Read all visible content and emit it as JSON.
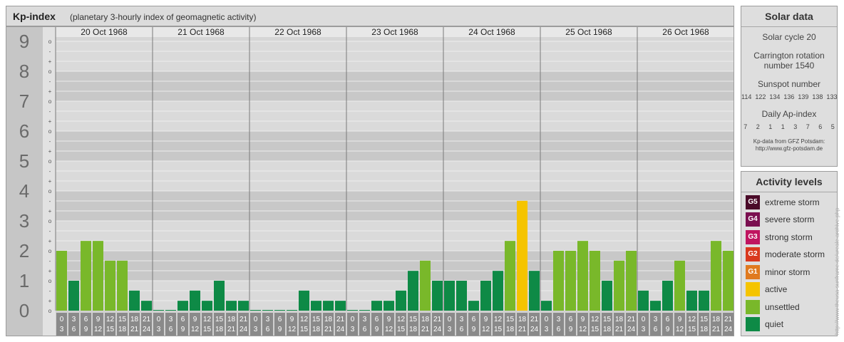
{
  "header": {
    "title": "Kp-index",
    "subtitle": "(planetary 3-hourly index of geomagnetic activity)"
  },
  "chart_data": {
    "type": "bar",
    "ylim": [
      0,
      9
    ],
    "y_ticks": [
      "0",
      "1",
      "2",
      "3",
      "4",
      "5",
      "6",
      "7",
      "8",
      "9"
    ],
    "sub_ticks": [
      "+",
      "o",
      "-"
    ],
    "days": [
      "20 Oct 1968",
      "21 Oct 1968",
      "22 Oct 1968",
      "23 Oct 1968",
      "24 Oct 1968",
      "25 Oct 1968",
      "26 Oct 1968"
    ],
    "slot_top": [
      "0",
      "3",
      "6",
      "9",
      "12",
      "15",
      "18",
      "21"
    ],
    "slot_bottom": [
      "3",
      "6",
      "9",
      "12",
      "15",
      "18",
      "21",
      "24"
    ],
    "values": [
      [
        2.0,
        1.0,
        2.33,
        2.33,
        1.67,
        1.67,
        0.67,
        0.33
      ],
      [
        0.0,
        0.0,
        0.33,
        0.67,
        0.33,
        1.0,
        0.33,
        0.33
      ],
      [
        0.0,
        0.0,
        0.0,
        0.0,
        0.67,
        0.33,
        0.33,
        0.33
      ],
      [
        0.0,
        0.0,
        0.33,
        0.33,
        0.67,
        1.33,
        1.67,
        1.0
      ],
      [
        1.0,
        1.0,
        0.33,
        1.0,
        1.33,
        2.33,
        3.67,
        1.33
      ],
      [
        0.33,
        2.0,
        2.0,
        2.33,
        2.0,
        1.0,
        1.67,
        2.0
      ],
      [
        0.67,
        0.33,
        1.0,
        1.67,
        0.67,
        0.67,
        2.33,
        2.0
      ]
    ],
    "colors": {
      "quiet": "#0e8a46",
      "unsettled": "#79b82a",
      "active": "#f5c400",
      "g1": "#e07a1f",
      "g2": "#d9391e",
      "g3": "#c01560",
      "g4": "#7a1050",
      "g5": "#4a0a28"
    }
  },
  "solar": {
    "title": "Solar data",
    "cycle": "Solar cycle 20",
    "carrington_1": "Carrington rotation",
    "carrington_2": "number 1540",
    "sunspot_title": "Sunspot number",
    "sunspot_values": "114  122  134  136  139  138  133",
    "ap_title": "Daily Ap-index",
    "ap_values": "7     2     1     1     3     7     6     5",
    "note_1": "Kp-data from GFZ Potsdam:",
    "note_2": "http://www.gfz-potsdam.de"
  },
  "activity": {
    "title": "Activity levels",
    "items": [
      {
        "badge": "G5",
        "label": "extreme storm",
        "color": "#4a0a28"
      },
      {
        "badge": "G4",
        "label": "severe storm",
        "color": "#7a1050"
      },
      {
        "badge": "G3",
        "label": "strong storm",
        "color": "#c01560"
      },
      {
        "badge": "G2",
        "label": "moderate storm",
        "color": "#d9391e"
      },
      {
        "badge": "G1",
        "label": "minor storm",
        "color": "#e07a1f"
      },
      {
        "badge": "",
        "label": "active",
        "color": "#f5c400"
      },
      {
        "badge": "",
        "label": "unsettled",
        "color": "#79b82a"
      },
      {
        "badge": "",
        "label": "quiet",
        "color": "#0e8a46"
      }
    ]
  },
  "watermark": "http://www.theusa-sunframe.de/ureale.archive.php"
}
